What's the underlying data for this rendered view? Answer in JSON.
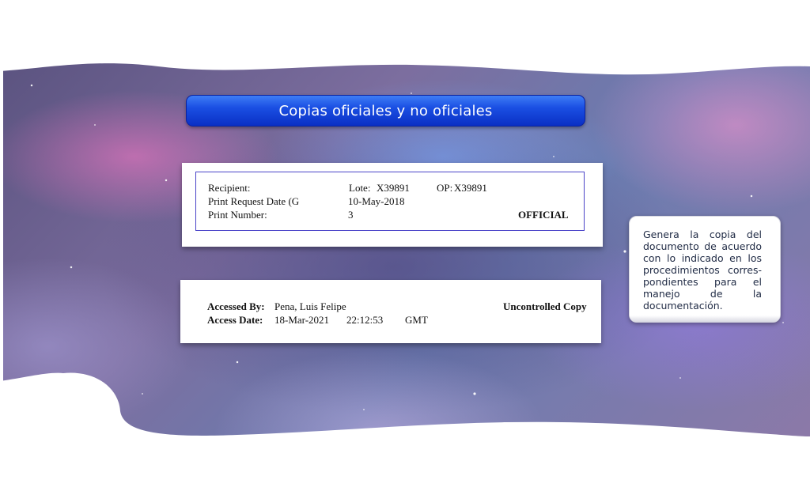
{
  "title": "Copias oficiales y no oficiales",
  "official_card": {
    "recipient_label": "Recipient:",
    "print_request_date_label": "Print Request Date (G",
    "print_number_label": "Print Number:",
    "lote_label": "Lote:",
    "lote_value": "X39891",
    "op_label": "OP:",
    "op_value": "X39891",
    "print_request_date_value": "10-May-2018",
    "print_number_value": "3",
    "stamp": "OFFICIAL"
  },
  "uncontrolled_card": {
    "accessed_by_label": "Accessed By:",
    "accessed_by_value": "Pena, Luis Felipe",
    "access_date_label": "Access Date:",
    "access_date_value": "18-Mar-2021",
    "access_time_value": "22:12:53",
    "timezone_value": "GMT",
    "stamp": "Uncontrolled Copy"
  },
  "note": {
    "text": "Genera la copia del documento de acuerdo con lo indicado en los procedimientos corres-pondientes para el manejo de la documentación."
  },
  "colors": {
    "title_bar": "#1a4fe3",
    "inner_border": "#4a44c8"
  }
}
